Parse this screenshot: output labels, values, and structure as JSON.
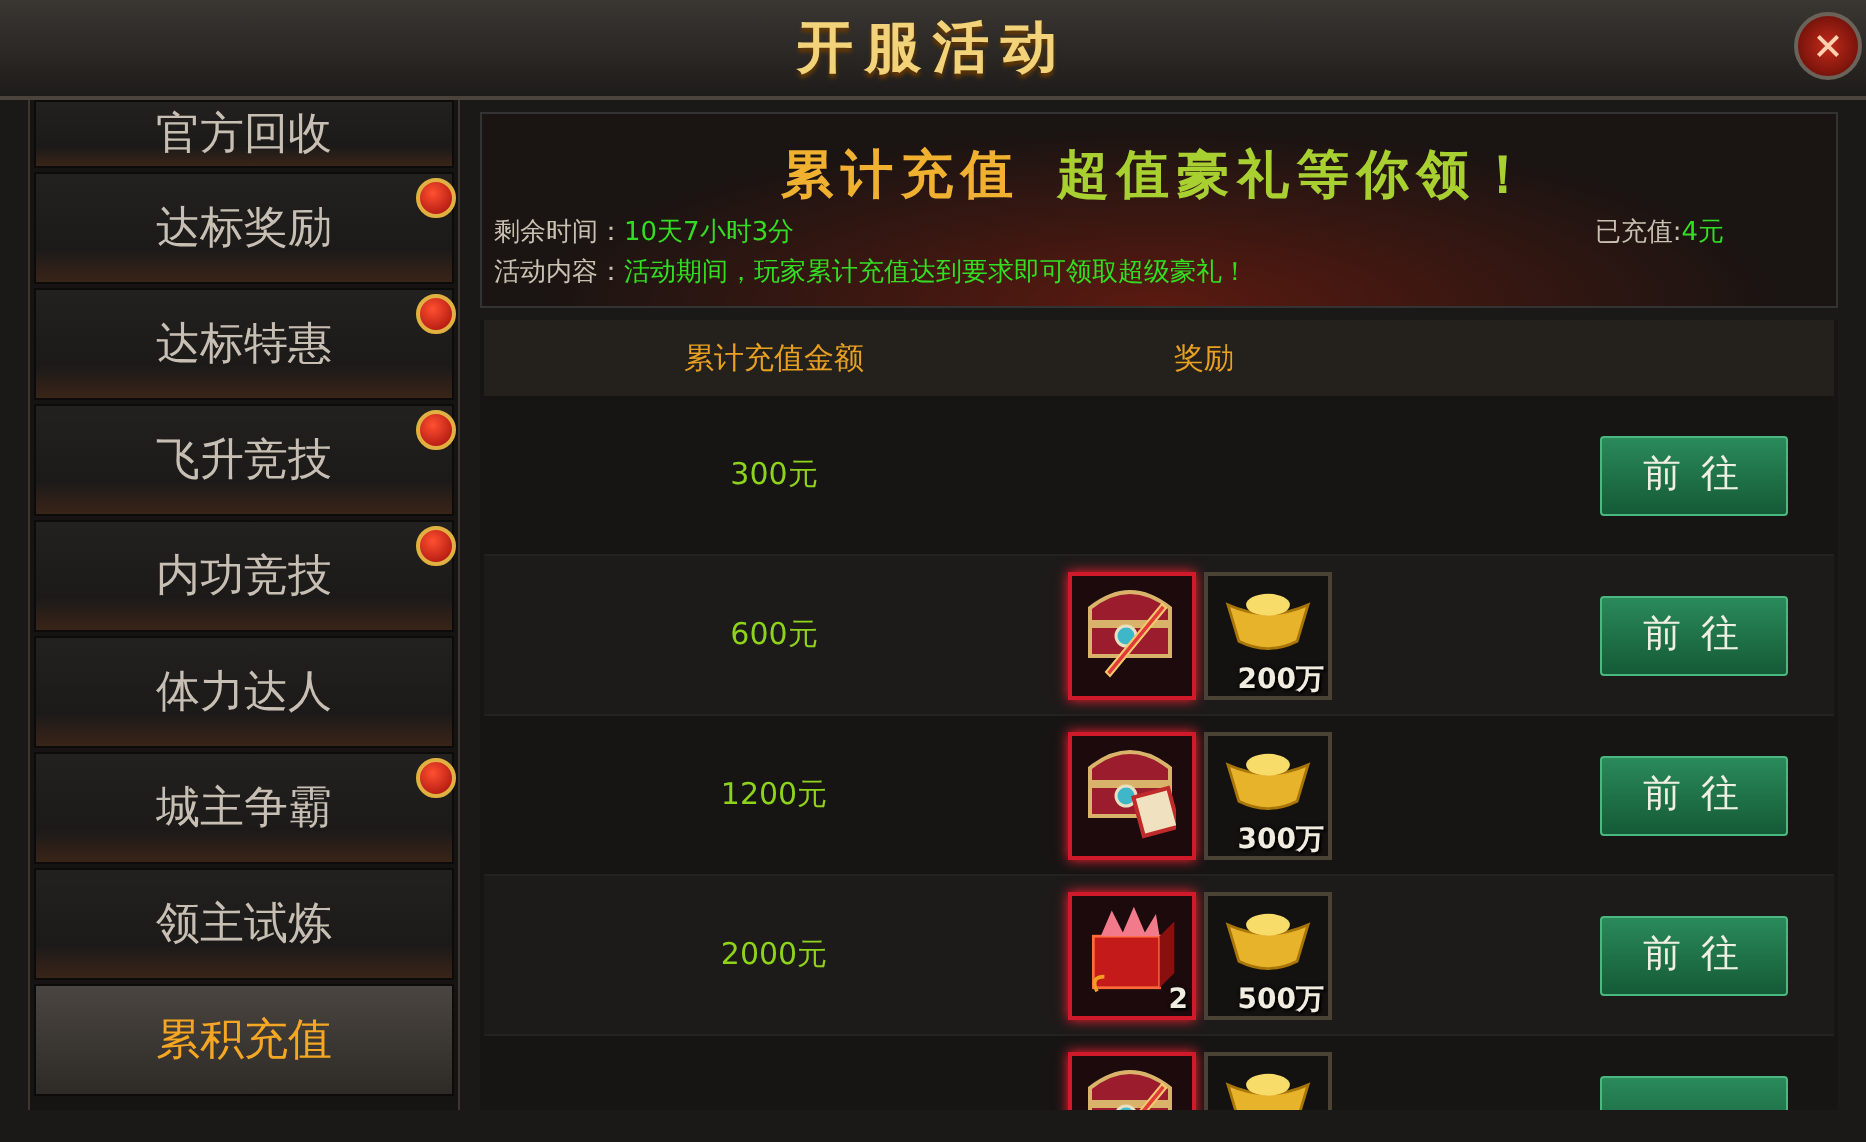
{
  "window": {
    "title": "开服活动"
  },
  "sidebar": {
    "items": [
      {
        "label": "官方回收",
        "selected": false,
        "badge": false
      },
      {
        "label": "达标奖励",
        "selected": false,
        "badge": true
      },
      {
        "label": "达标特惠",
        "selected": false,
        "badge": true
      },
      {
        "label": "飞升竞技",
        "selected": false,
        "badge": true
      },
      {
        "label": "内功竞技",
        "selected": false,
        "badge": true
      },
      {
        "label": "体力达人",
        "selected": false,
        "badge": false
      },
      {
        "label": "城主争霸",
        "selected": false,
        "badge": true
      },
      {
        "label": "领主试炼",
        "selected": false,
        "badge": false
      },
      {
        "label": "累积充值",
        "selected": true,
        "badge": false
      }
    ]
  },
  "banner": {
    "title_part_1": "累计充值",
    "title_part_2": "超值豪礼等你领！",
    "time_label": "剩余时间：",
    "time_value": "10天7小时3分",
    "content_label": "活动内容：",
    "content_value": "活动期间，玩家累计充值达到要求即可领取超级豪礼！",
    "recharged_label": "已充值:",
    "recharged_value": "4元"
  },
  "table": {
    "columns": [
      "累计充值金额",
      "奖励"
    ],
    "rows": [
      {
        "amount": "300元",
        "rewards": [],
        "button": "前 往"
      },
      {
        "amount": "600元",
        "rewards": [
          {
            "kind": "chest_sword"
          },
          {
            "kind": "gold_ingot",
            "count": "200万"
          }
        ],
        "button": "前 往"
      },
      {
        "amount": "1200元",
        "rewards": [
          {
            "kind": "chest_book"
          },
          {
            "kind": "gold_ingot",
            "count": "300万"
          }
        ],
        "button": "前 往"
      },
      {
        "amount": "2000元",
        "rewards": [
          {
            "kind": "gift_box",
            "count": "2"
          },
          {
            "kind": "gold_ingot",
            "count": "500万"
          }
        ],
        "button": "前 往"
      },
      {
        "rewards": [
          {
            "kind": "chest_sword"
          },
          {
            "kind": "gold_ingot"
          }
        ]
      }
    ]
  }
}
